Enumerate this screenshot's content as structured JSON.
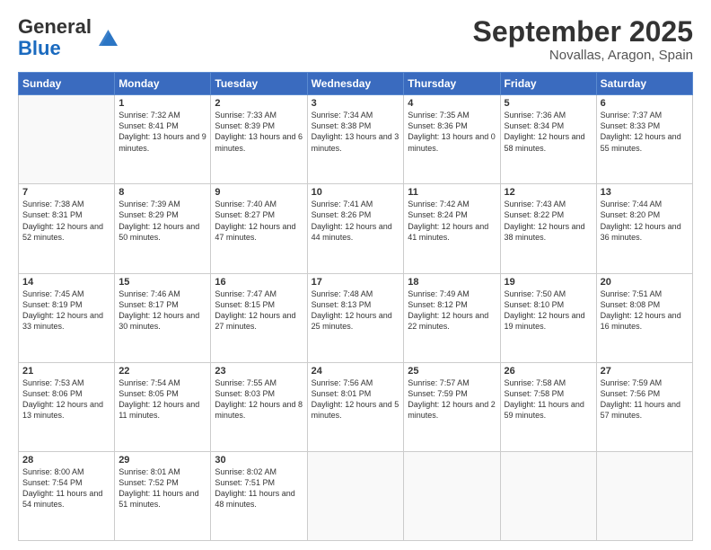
{
  "logo": {
    "general": "General",
    "blue": "Blue"
  },
  "header": {
    "month": "September 2025",
    "location": "Novallas, Aragon, Spain"
  },
  "weekdays": [
    "Sunday",
    "Monday",
    "Tuesday",
    "Wednesday",
    "Thursday",
    "Friday",
    "Saturday"
  ],
  "weeks": [
    [
      {
        "day": "",
        "info": ""
      },
      {
        "day": "1",
        "info": "Sunrise: 7:32 AM\nSunset: 8:41 PM\nDaylight: 13 hours\nand 9 minutes."
      },
      {
        "day": "2",
        "info": "Sunrise: 7:33 AM\nSunset: 8:39 PM\nDaylight: 13 hours\nand 6 minutes."
      },
      {
        "day": "3",
        "info": "Sunrise: 7:34 AM\nSunset: 8:38 PM\nDaylight: 13 hours\nand 3 minutes."
      },
      {
        "day": "4",
        "info": "Sunrise: 7:35 AM\nSunset: 8:36 PM\nDaylight: 13 hours\nand 0 minutes."
      },
      {
        "day": "5",
        "info": "Sunrise: 7:36 AM\nSunset: 8:34 PM\nDaylight: 12 hours\nand 58 minutes."
      },
      {
        "day": "6",
        "info": "Sunrise: 7:37 AM\nSunset: 8:33 PM\nDaylight: 12 hours\nand 55 minutes."
      }
    ],
    [
      {
        "day": "7",
        "info": "Sunrise: 7:38 AM\nSunset: 8:31 PM\nDaylight: 12 hours\nand 52 minutes."
      },
      {
        "day": "8",
        "info": "Sunrise: 7:39 AM\nSunset: 8:29 PM\nDaylight: 12 hours\nand 50 minutes."
      },
      {
        "day": "9",
        "info": "Sunrise: 7:40 AM\nSunset: 8:27 PM\nDaylight: 12 hours\nand 47 minutes."
      },
      {
        "day": "10",
        "info": "Sunrise: 7:41 AM\nSunset: 8:26 PM\nDaylight: 12 hours\nand 44 minutes."
      },
      {
        "day": "11",
        "info": "Sunrise: 7:42 AM\nSunset: 8:24 PM\nDaylight: 12 hours\nand 41 minutes."
      },
      {
        "day": "12",
        "info": "Sunrise: 7:43 AM\nSunset: 8:22 PM\nDaylight: 12 hours\nand 38 minutes."
      },
      {
        "day": "13",
        "info": "Sunrise: 7:44 AM\nSunset: 8:20 PM\nDaylight: 12 hours\nand 36 minutes."
      }
    ],
    [
      {
        "day": "14",
        "info": "Sunrise: 7:45 AM\nSunset: 8:19 PM\nDaylight: 12 hours\nand 33 minutes."
      },
      {
        "day": "15",
        "info": "Sunrise: 7:46 AM\nSunset: 8:17 PM\nDaylight: 12 hours\nand 30 minutes."
      },
      {
        "day": "16",
        "info": "Sunrise: 7:47 AM\nSunset: 8:15 PM\nDaylight: 12 hours\nand 27 minutes."
      },
      {
        "day": "17",
        "info": "Sunrise: 7:48 AM\nSunset: 8:13 PM\nDaylight: 12 hours\nand 25 minutes."
      },
      {
        "day": "18",
        "info": "Sunrise: 7:49 AM\nSunset: 8:12 PM\nDaylight: 12 hours\nand 22 minutes."
      },
      {
        "day": "19",
        "info": "Sunrise: 7:50 AM\nSunset: 8:10 PM\nDaylight: 12 hours\nand 19 minutes."
      },
      {
        "day": "20",
        "info": "Sunrise: 7:51 AM\nSunset: 8:08 PM\nDaylight: 12 hours\nand 16 minutes."
      }
    ],
    [
      {
        "day": "21",
        "info": "Sunrise: 7:53 AM\nSunset: 8:06 PM\nDaylight: 12 hours\nand 13 minutes."
      },
      {
        "day": "22",
        "info": "Sunrise: 7:54 AM\nSunset: 8:05 PM\nDaylight: 12 hours\nand 11 minutes."
      },
      {
        "day": "23",
        "info": "Sunrise: 7:55 AM\nSunset: 8:03 PM\nDaylight: 12 hours\nand 8 minutes."
      },
      {
        "day": "24",
        "info": "Sunrise: 7:56 AM\nSunset: 8:01 PM\nDaylight: 12 hours\nand 5 minutes."
      },
      {
        "day": "25",
        "info": "Sunrise: 7:57 AM\nSunset: 7:59 PM\nDaylight: 12 hours\nand 2 minutes."
      },
      {
        "day": "26",
        "info": "Sunrise: 7:58 AM\nSunset: 7:58 PM\nDaylight: 11 hours\nand 59 minutes."
      },
      {
        "day": "27",
        "info": "Sunrise: 7:59 AM\nSunset: 7:56 PM\nDaylight: 11 hours\nand 57 minutes."
      }
    ],
    [
      {
        "day": "28",
        "info": "Sunrise: 8:00 AM\nSunset: 7:54 PM\nDaylight: 11 hours\nand 54 minutes."
      },
      {
        "day": "29",
        "info": "Sunrise: 8:01 AM\nSunset: 7:52 PM\nDaylight: 11 hours\nand 51 minutes."
      },
      {
        "day": "30",
        "info": "Sunrise: 8:02 AM\nSunset: 7:51 PM\nDaylight: 11 hours\nand 48 minutes."
      },
      {
        "day": "",
        "info": ""
      },
      {
        "day": "",
        "info": ""
      },
      {
        "day": "",
        "info": ""
      },
      {
        "day": "",
        "info": ""
      }
    ]
  ]
}
